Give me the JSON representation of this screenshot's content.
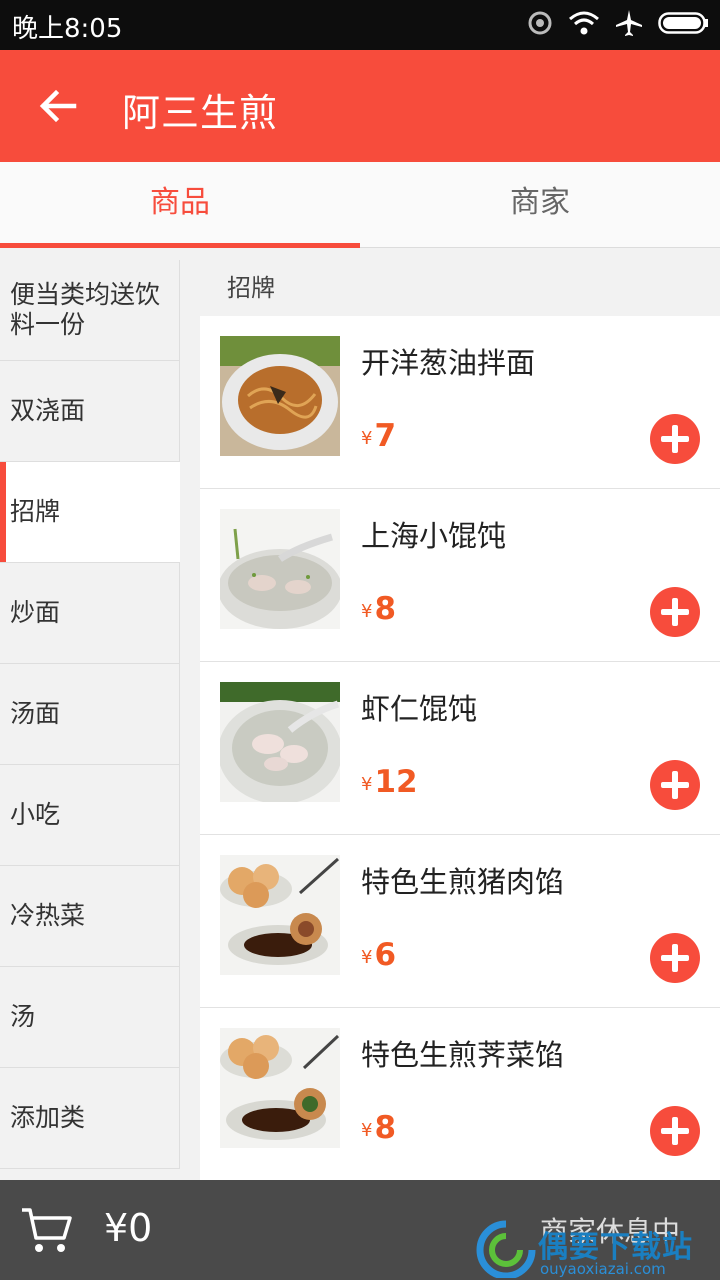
{
  "status_bar": {
    "time": "晚上8:05"
  },
  "header": {
    "title": "阿三生煎"
  },
  "tabs": [
    {
      "label": "商品",
      "active": true
    },
    {
      "label": "商家",
      "active": false
    }
  ],
  "sidebar": {
    "categories": [
      {
        "label": "便当类均送饮料一份",
        "active": false
      },
      {
        "label": "双浇面",
        "active": false
      },
      {
        "label": "招牌",
        "active": true
      },
      {
        "label": "炒面",
        "active": false
      },
      {
        "label": "汤面",
        "active": false
      },
      {
        "label": "小吃",
        "active": false
      },
      {
        "label": "冷热菜",
        "active": false
      },
      {
        "label": "汤",
        "active": false
      },
      {
        "label": "添加类",
        "active": false
      }
    ]
  },
  "section": {
    "title": "招牌"
  },
  "products": [
    {
      "name": "开洋葱油拌面",
      "currency": "¥",
      "price": "7"
    },
    {
      "name": "上海小馄饨",
      "currency": "¥",
      "price": "8"
    },
    {
      "name": "虾仁馄饨",
      "currency": "¥",
      "price": "12"
    },
    {
      "name": "特色生煎猪肉馅",
      "currency": "¥",
      "price": "6"
    },
    {
      "name": "特色生煎荠菜馅",
      "currency": "¥",
      "price": "8"
    }
  ],
  "cart": {
    "total": "¥0",
    "status": "商家休息中"
  },
  "watermark": {
    "text": "偶要下载站",
    "url": "ouyaoxiazai.com"
  },
  "colors": {
    "accent": "#f74c3c",
    "price": "#f15a24",
    "bottom_bar": "#4a4a4a"
  }
}
